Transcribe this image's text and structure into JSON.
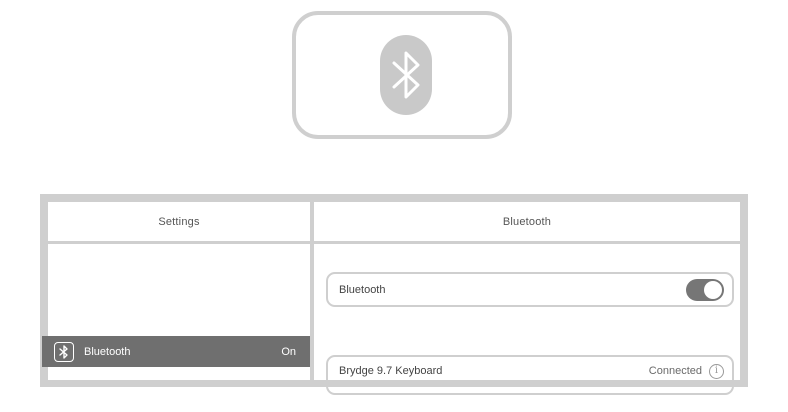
{
  "icon_card": {
    "icon": "bluetooth-icon"
  },
  "left_pane": {
    "title": "Settings",
    "selected_item": {
      "icon": "bluetooth-icon",
      "label": "Bluetooth",
      "value": "On"
    }
  },
  "right_pane": {
    "title": "Bluetooth",
    "toggle_row": {
      "label": "Bluetooth",
      "state": "on"
    },
    "device": {
      "name": "Brydge 9.7 Keyboard",
      "status": "Connected",
      "icon": "info-icon"
    }
  },
  "colors": {
    "frame": "#cfcfcf",
    "selected_row": "#6f6f6f",
    "toggle_on": "#767676",
    "icon_pill": "#c9c9c9"
  }
}
